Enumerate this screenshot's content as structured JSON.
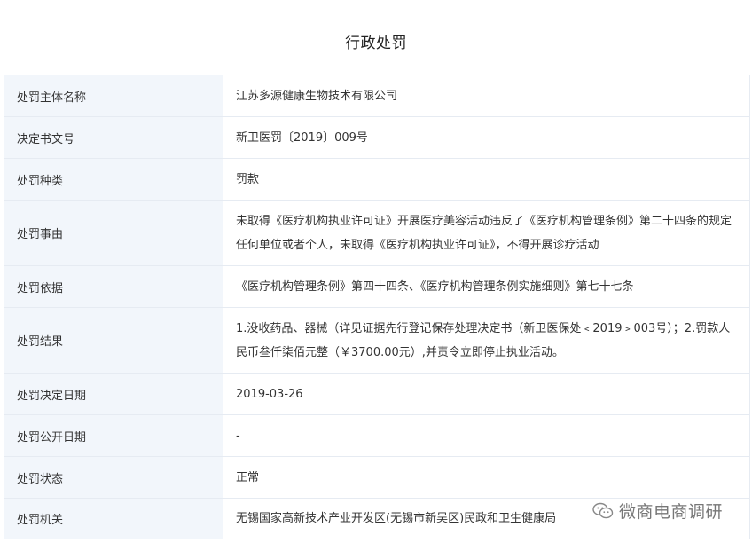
{
  "title": "行政处罚",
  "rows": [
    {
      "label": "处罚主体名称",
      "value": "江苏多源健康生物技术有限公司"
    },
    {
      "label": "决定书文号",
      "value": "新卫医罚〔2019〕009号"
    },
    {
      "label": "处罚种类",
      "value": "罚款"
    },
    {
      "label": "处罚事由",
      "value": "未取得《医疗机构执业许可证》开展医疗美容活动违反了《医疗机构管理条例》第二十四条的规定任何单位或者个人，未取得《医疗机构执业许可证》，不得开展诊疗活动"
    },
    {
      "label": "处罚依据",
      "value": "《医疗机构管理条例》第四十四条、《医疗机构管理条例实施细则》第七十七条"
    },
    {
      "label": "处罚结果",
      "value": "1.没收药品、器械（详见证据先行登记保存处理决定书（新卫医保处﹤2019﹥003号）；2.罚款人民币叁仟柒佰元整（￥3700.00元）,并责令立即停止执业活动。"
    },
    {
      "label": "处罚决定日期",
      "value": "2019-03-26"
    },
    {
      "label": "处罚公开日期",
      "value": "-"
    },
    {
      "label": "处罚状态",
      "value": "正常"
    },
    {
      "label": "处罚机关",
      "value": "无锡国家高新技术产业开发区(无锡市新吴区)民政和卫生健康局"
    }
  ],
  "watermark": {
    "icon": "wechat-icon",
    "text": "微商电商调研"
  }
}
